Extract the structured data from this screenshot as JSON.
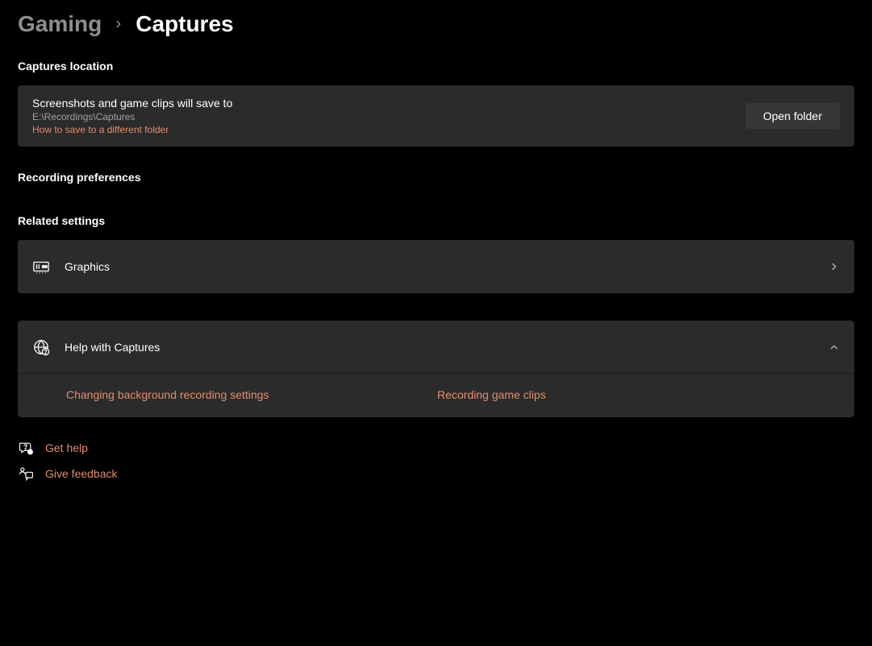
{
  "breadcrumb": {
    "parent": "Gaming",
    "current": "Captures"
  },
  "location": {
    "header": "Captures location",
    "title": "Screenshots and game clips will save to",
    "path": "E:\\Recordings\\Captures",
    "howto": "How to save to a different folder",
    "button": "Open folder"
  },
  "prefs_header": "Recording preferences",
  "related": {
    "header": "Related settings",
    "graphics": "Graphics"
  },
  "help": {
    "title": "Help with Captures",
    "links": [
      "Changing background recording settings",
      "Recording game clips"
    ]
  },
  "footer": {
    "gethelp": "Get help",
    "feedback": "Give feedback"
  }
}
